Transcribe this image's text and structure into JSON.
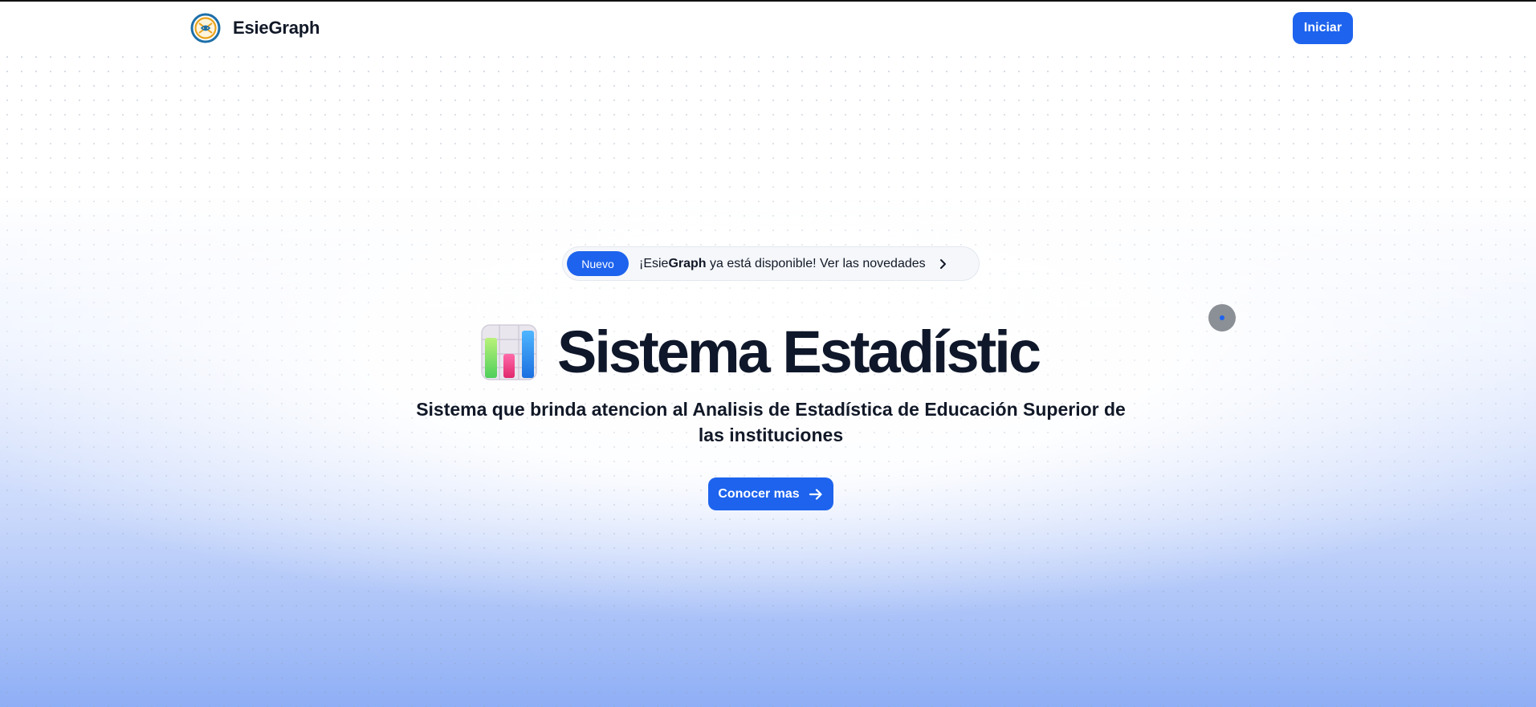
{
  "header": {
    "brand_name": "EsieGraph",
    "login_label": "Iniciar"
  },
  "announcement": {
    "badge": "Nuevo",
    "text_prefix": "¡Esie",
    "text_bold": "Graph",
    "text_suffix": " ya está disponible! Ver las novedades"
  },
  "hero": {
    "title": "Sistema Estadístic",
    "subtitle": "Sistema que brinda atencion al Analisis de Estadística de Educación Superior de las instituciones",
    "cta_label": "Conocer mas"
  },
  "colors": {
    "accent": "#1d63ed",
    "text": "#0f172a",
    "logo_ring": "#1e6fa8",
    "logo_inner": "#e8a21a"
  },
  "icons": {
    "brand": "globe-logo-icon",
    "announce": "chevron-right-icon",
    "hero": "bar-chart-icon",
    "cta": "arrow-right-icon"
  }
}
